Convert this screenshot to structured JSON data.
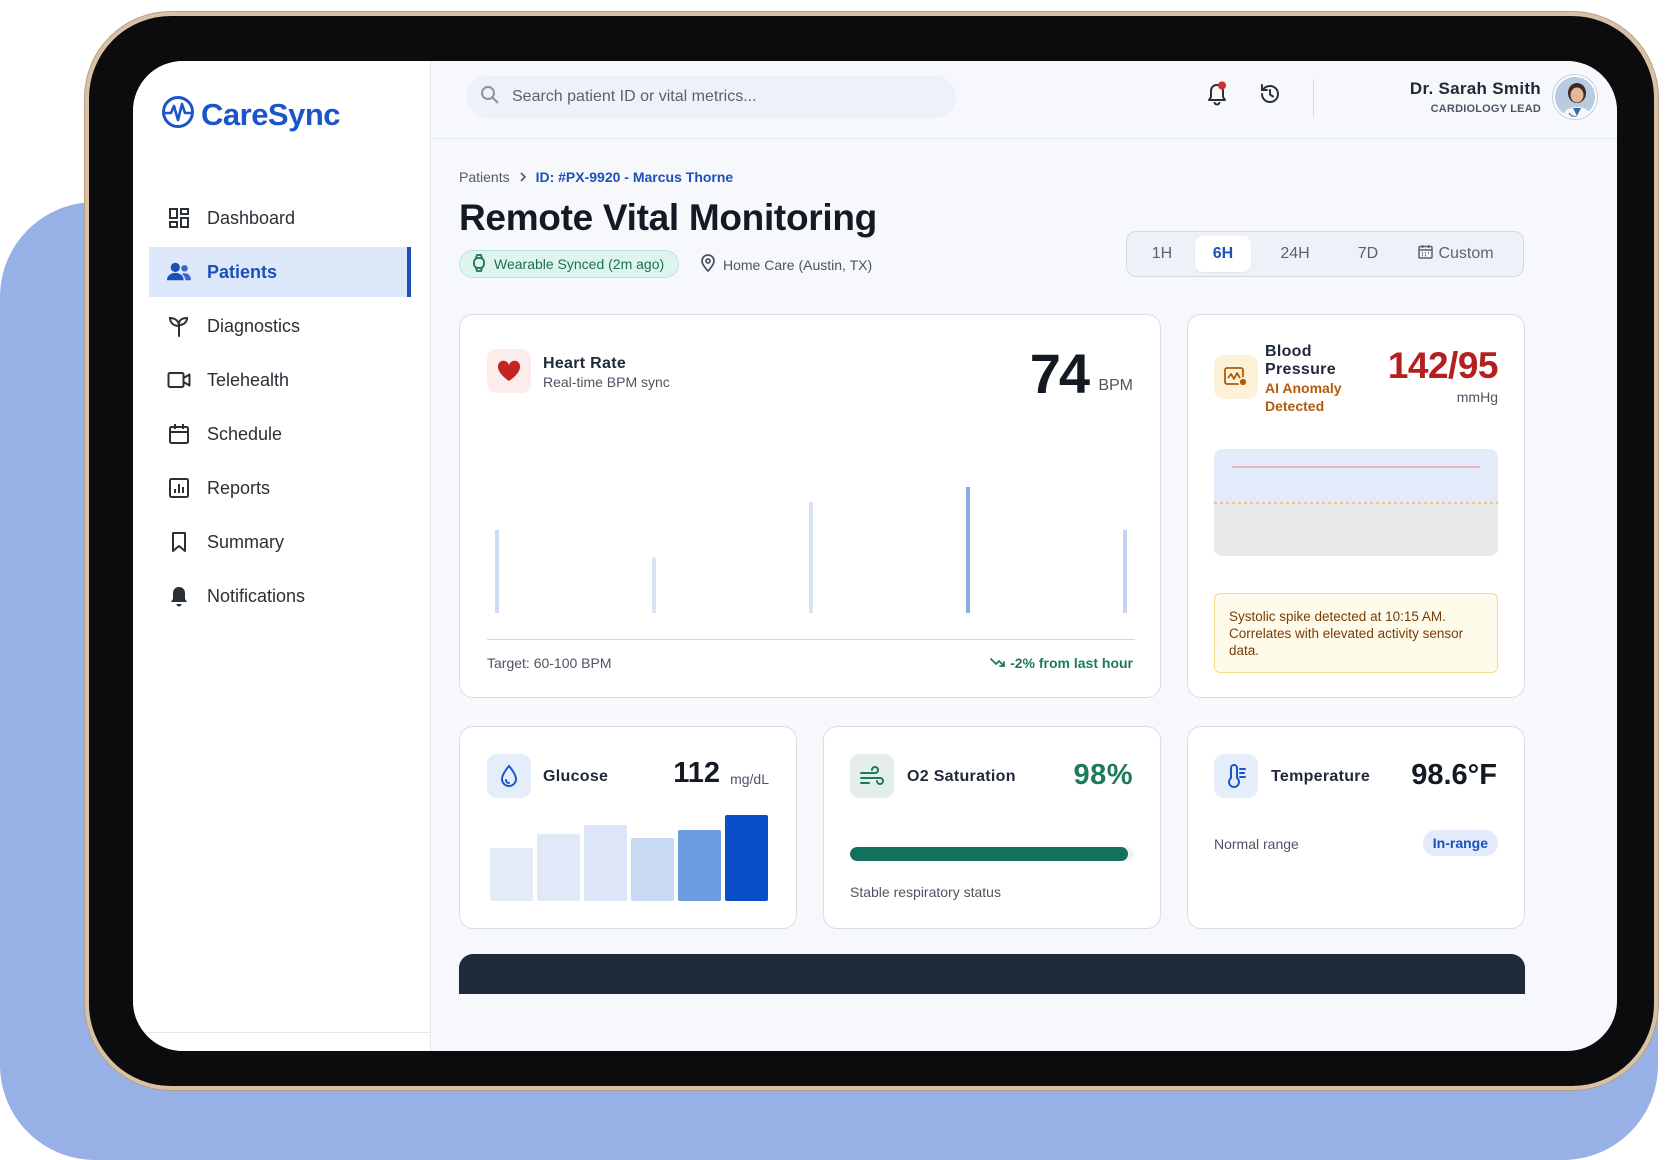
{
  "app": {
    "name": "CareSync"
  },
  "sidebar": {
    "items": [
      {
        "label": "Dashboard",
        "icon": "dashboard-icon"
      },
      {
        "label": "Patients",
        "icon": "patients-icon",
        "active": true
      },
      {
        "label": "Diagnostics",
        "icon": "diagnostics-icon"
      },
      {
        "label": "Telehealth",
        "icon": "video-icon"
      },
      {
        "label": "Schedule",
        "icon": "calendar-icon"
      },
      {
        "label": "Reports",
        "icon": "reports-icon"
      },
      {
        "label": "Summary",
        "icon": "bookmark-icon"
      },
      {
        "label": "Notifications",
        "icon": "bell-icon"
      }
    ]
  },
  "topbar": {
    "search_placeholder": "Search patient ID or vital metrics...",
    "user_name": "Dr. Sarah Smith",
    "user_role": "CARDIOLOGY LEAD"
  },
  "breadcrumb": {
    "parent": "Patients",
    "current": "ID: #PX-9920 - Marcus Thorne"
  },
  "page": {
    "title": "Remote Vital Monitoring",
    "sync_status": "Wearable Synced (2m ago)",
    "location": "Home Care (Austin, TX)"
  },
  "time_range": {
    "options": [
      "1H",
      "6H",
      "24H",
      "7D",
      "Custom"
    ],
    "selected": "6H"
  },
  "heart_rate": {
    "title": "Heart Rate",
    "subtitle": "Real-time BPM sync",
    "value": "74",
    "unit": "BPM",
    "target": "Target: 60-100 BPM",
    "trend": "-2% from last hour",
    "spikes": [
      0.66,
      0.44,
      0.88,
      1.0,
      0.66
    ],
    "spike_opacity": [
      0.25,
      0.2,
      0.2,
      0.6,
      0.3
    ]
  },
  "blood_pressure": {
    "title": "Blood Pressure",
    "anomaly": "AI Anomaly Detected",
    "value": "142/95",
    "unit": "mmHg",
    "alert": "Systolic spike detected at 10:15 AM. Correlates with elevated activity sensor data."
  },
  "glucose": {
    "title": "Glucose",
    "value": "112",
    "unit": "mg/dL",
    "bars": [
      0.62,
      0.78,
      0.88,
      0.73,
      0.83,
      1.0
    ],
    "bar_colors": [
      "#e6ecf7",
      "#e1e9f8",
      "#dde6f8",
      "#c9d9f4",
      "#6d9be0",
      "#0a4fc9"
    ]
  },
  "o2": {
    "title": "O2 Saturation",
    "value": "98%",
    "fill": 0.98,
    "footer": "Stable respiratory status"
  },
  "temperature": {
    "title": "Temperature",
    "value": "98.6°F",
    "footer": "Normal range",
    "badge": "In-range"
  },
  "colors": {
    "brand": "#1a56c9",
    "success": "#1f7a5a",
    "danger": "#b3201e",
    "warning": "#b35b0a"
  }
}
